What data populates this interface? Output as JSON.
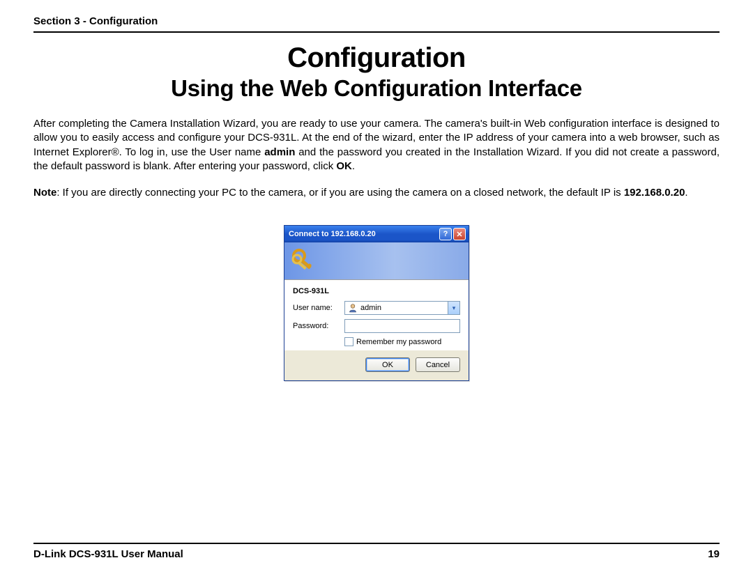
{
  "header": {
    "section": "Section 3 - Configuration"
  },
  "titles": {
    "main": "Configuration",
    "sub": "Using the Web Configuration Interface"
  },
  "paragraph": {
    "p1a": "After completing the Camera Installation Wizard, you are ready to use your camera. The camera's built-in Web configuration interface is designed to allow you to easily access and configure your DCS-931L. At the end of the wizard, enter the IP address of your camera into a web browser, such as Internet Explorer®. To log in, use the User name ",
    "p1_bold1": "admin",
    "p1b": " and the password you created in the Installation Wizard. If you did not create a password, the default password is blank. After entering your password, click ",
    "p1_bold2": "OK",
    "p1c": "."
  },
  "note": {
    "label": "Note",
    "text": ": If you are directly connecting your PC to the camera, or if you are using the camera on a closed network, the default IP is ",
    "ip": "192.168.0.20",
    "tail": "."
  },
  "dialog": {
    "title": "Connect to 192.168.0.20",
    "help": "?",
    "close": "✕",
    "group": "DCS-931L",
    "username_label": "User name:",
    "username_value": "admin",
    "password_label": "Password:",
    "remember": "Remember my password",
    "ok": "OK",
    "cancel": "Cancel"
  },
  "footer": {
    "manual": "D-Link DCS-931L User Manual",
    "page": "19"
  }
}
